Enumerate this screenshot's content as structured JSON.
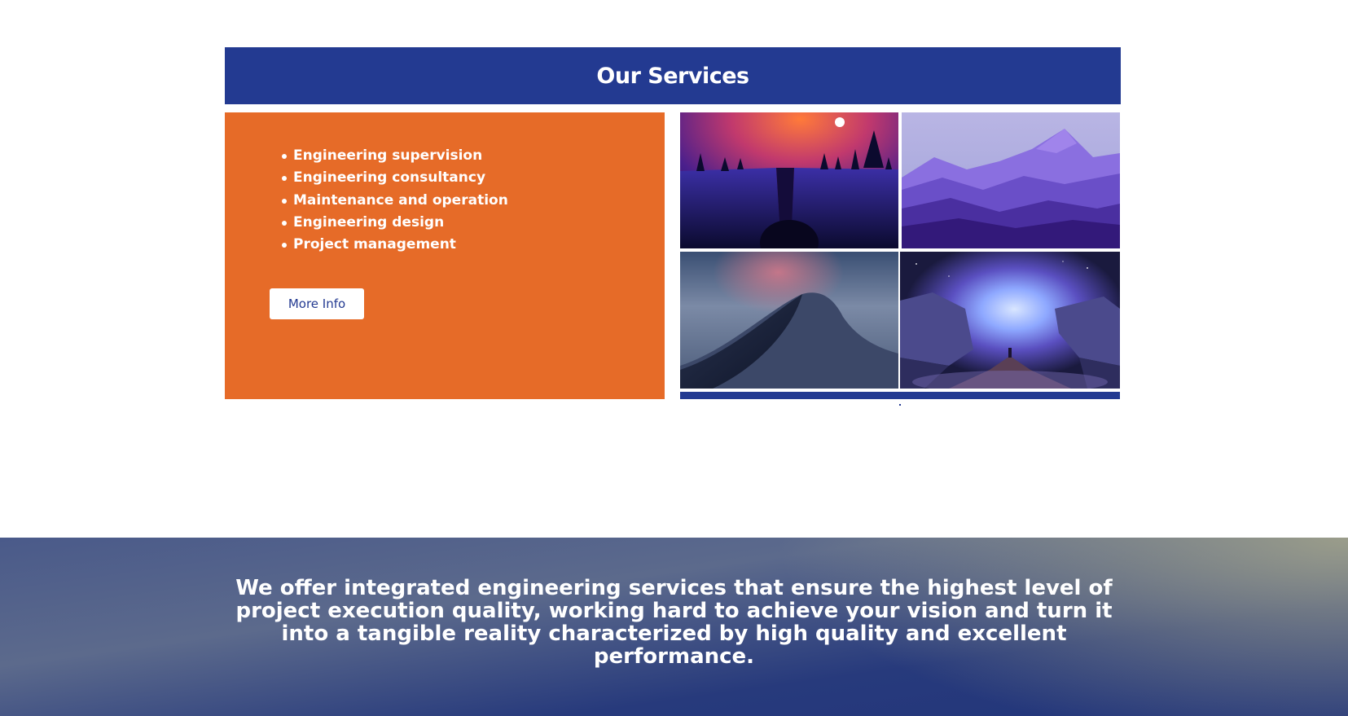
{
  "services": {
    "title": "Our Services",
    "items": [
      "Engineering supervision",
      "Engineering consultancy",
      "Maintenance and operation",
      "Engineering design",
      "Project management"
    ],
    "more_info_label": "More Info"
  },
  "gallery": {
    "images": [
      "night-canyon-sunset-illustration",
      "purple-mountains-illustration",
      "desert-dune-illustration",
      "cosmic-nebula-rocks-illustration"
    ]
  },
  "banner": {
    "text": "We offer integrated engineering services that ensure the highest level of project execution quality, working hard to achieve your vision and turn it into a tangible reality characterized by high quality and excellent performance."
  },
  "colors": {
    "primary_blue": "#233a91",
    "accent_orange": "#e66b28",
    "white": "#ffffff"
  }
}
